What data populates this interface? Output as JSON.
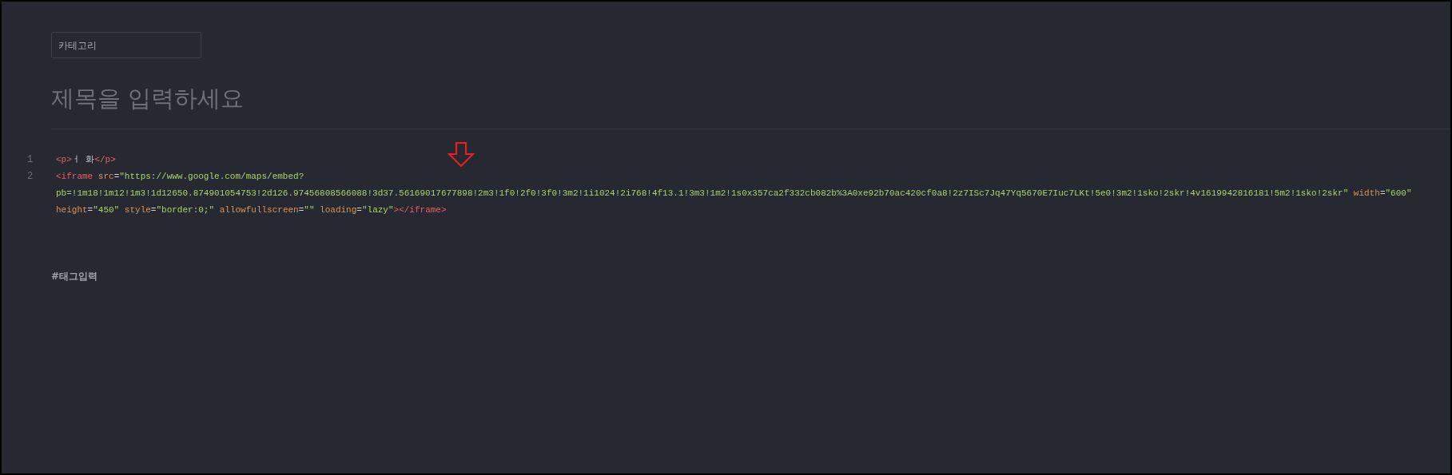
{
  "category_field": {
    "placeholder": "카테고리"
  },
  "title_field": {
    "placeholder": "제목을 입력하세요"
  },
  "code_lines": [
    {
      "number": "1",
      "tokens": [
        {
          "kind": "tag",
          "text": "<p>"
        },
        {
          "kind": "text",
          "text": "ㅓ 화"
        },
        {
          "kind": "tag",
          "text": "</p>"
        }
      ]
    },
    {
      "number": "2",
      "tokens": [
        {
          "kind": "tag",
          "text": "<iframe"
        },
        {
          "kind": "attr",
          "text": " src"
        },
        {
          "kind": "punct",
          "text": "="
        },
        {
          "kind": "string",
          "text": "\"https://www.google.com/maps/embed?pb=!1m18!1m12!1m3!1d12650.874901054753!2d126.97456808566088!3d37.56169017677898!2m3!1f0!2f0!3f0!3m2!1i1024!2i768!4f13.1!3m3!1m2!1s0x357ca2f332cb082b%3A0xe92b70ac420cf0a8!2z7ISc7Jq47Yq5670E7Iuc7LKt!5e0!3m2!1sko!2skr!4v1619942816181!5m2!1sko!2skr\""
        },
        {
          "kind": "attr",
          "text": " width"
        },
        {
          "kind": "punct",
          "text": "="
        },
        {
          "kind": "string",
          "text": "\"600\""
        },
        {
          "kind": "attr",
          "text": " height"
        },
        {
          "kind": "punct",
          "text": "="
        },
        {
          "kind": "string",
          "text": "\"450\""
        },
        {
          "kind": "attr",
          "text": " style"
        },
        {
          "kind": "punct",
          "text": "="
        },
        {
          "kind": "string",
          "text": "\"border:0;\""
        },
        {
          "kind": "attr",
          "text": " allowfullscreen"
        },
        {
          "kind": "punct",
          "text": "="
        },
        {
          "kind": "string",
          "text": "\"\""
        },
        {
          "kind": "attr",
          "text": " loading"
        },
        {
          "kind": "punct",
          "text": "="
        },
        {
          "kind": "string",
          "text": "\"lazy\""
        },
        {
          "kind": "tag",
          "text": "></iframe>"
        }
      ]
    }
  ],
  "tag_field": {
    "placeholder": "#태그입력"
  }
}
